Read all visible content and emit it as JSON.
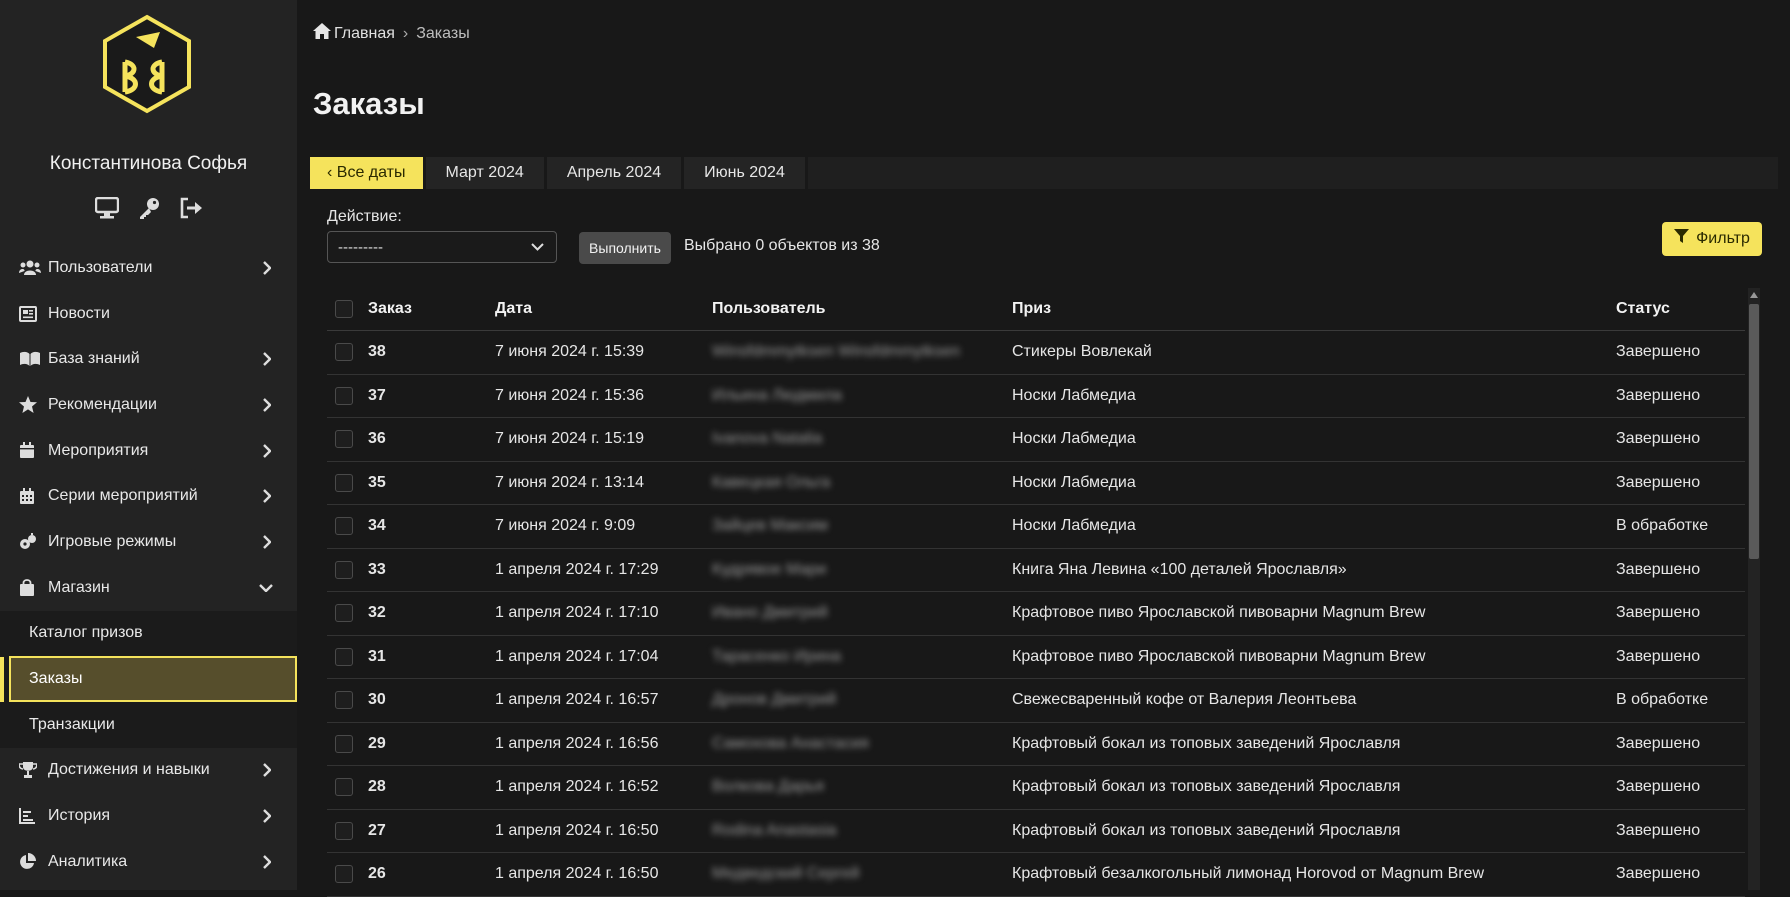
{
  "user": {
    "name": "Константинова Софья"
  },
  "user_icons": [
    "monitor-icon",
    "key-icon",
    "sign-out-icon"
  ],
  "sidebar": {
    "items": [
      {
        "label": "Пользователи",
        "icon": "users-icon",
        "chevron": "right"
      },
      {
        "label": "Новости",
        "icon": "newspaper-icon",
        "chevron": ""
      },
      {
        "label": "База знаний",
        "icon": "book-icon",
        "chevron": "right"
      },
      {
        "label": "Рекомендации",
        "icon": "star-icon",
        "chevron": "right"
      },
      {
        "label": "Мероприятия",
        "icon": "calendar-icon",
        "chevron": "right"
      },
      {
        "label": "Серии мероприятий",
        "icon": "calendar-grid-icon",
        "chevron": "right"
      },
      {
        "label": "Игровые режимы",
        "icon": "gamepad-icon",
        "chevron": "right"
      },
      {
        "label": "Магазин",
        "icon": "shopping-bag-icon",
        "chevron": "down"
      }
    ],
    "shop_subitems": [
      "Каталог призов",
      "Заказы",
      "Транзакции"
    ],
    "items_after": [
      {
        "label": "Достижения и навыки",
        "icon": "trophy-icon",
        "chevron": "right"
      },
      {
        "label": "История",
        "icon": "chart-bar-icon",
        "chevron": "right"
      },
      {
        "label": "Аналитика",
        "icon": "pie-chart-icon",
        "chevron": "right"
      }
    ]
  },
  "breadcrumb": {
    "home": "Главная",
    "separator": "›",
    "current": "Заказы"
  },
  "page_title": "Заказы",
  "date_filter": {
    "back": "‹ Все даты",
    "months": [
      "Март 2024",
      "Апрель 2024",
      "Июнь 2024"
    ]
  },
  "actions": {
    "label": "Действие:",
    "select_value": "---------",
    "run_button": "Выполнить",
    "selected_text": "Выбрано 0 объектов из 38"
  },
  "filter_button": "Фильтр",
  "table": {
    "headers": {
      "id": "Заказ",
      "date": "Дата",
      "user": "Пользователь",
      "prize": "Приз",
      "status": "Статус"
    },
    "rows": [
      {
        "id": "38",
        "date": "7 июня 2024 г. 15:39",
        "user": "Winsfdmmytksen Winsfdmmytksen",
        "prize": "Стикеры Вовлекай",
        "status": "Завершено"
      },
      {
        "id": "37",
        "date": "7 июня 2024 г. 15:36",
        "user": "Ильина Людмила",
        "prize": "Носки Лабмедиа",
        "status": "Завершено"
      },
      {
        "id": "36",
        "date": "7 июня 2024 г. 15:19",
        "user": "Ivanova Natalia",
        "prize": "Носки Лабмедиа",
        "status": "Завершено"
      },
      {
        "id": "35",
        "date": "7 июня 2024 г. 13:14",
        "user": "Кавецкая Ольга",
        "prize": "Носки Лабмедиа",
        "status": "Завершено"
      },
      {
        "id": "34",
        "date": "7 июня 2024 г. 9:09",
        "user": "Зайцев Максим",
        "prize": "Носки Лабмедиа",
        "status": "В обработке"
      },
      {
        "id": "33",
        "date": "1 апреля 2024 г. 17:29",
        "user": "Кудрявое Мари",
        "prize": "Книга Яна Левина «100 деталей Ярославля»",
        "status": "Завершено"
      },
      {
        "id": "32",
        "date": "1 апреля 2024 г. 17:10",
        "user": "Ивано Дмитрий",
        "prize": "Крафтовое пиво Ярославской пивоварни Magnum Brew",
        "status": "Завершено"
      },
      {
        "id": "31",
        "date": "1 апреля 2024 г. 17:04",
        "user": "Тарасенко Ирина",
        "prize": "Крафтовое пиво Ярославской пивоварни Magnum Brew",
        "status": "Завершено"
      },
      {
        "id": "30",
        "date": "1 апреля 2024 г. 16:57",
        "user": "Дронов Дмитрий",
        "prize": "Свежесваренный кофе от Валерия Леонтьева",
        "status": "В обработке"
      },
      {
        "id": "29",
        "date": "1 апреля 2024 г. 16:56",
        "user": "Самохова Анастасия",
        "prize": "Крафтовый бокал из топовых заведений Ярославля",
        "status": "Завершено"
      },
      {
        "id": "28",
        "date": "1 апреля 2024 г. 16:52",
        "user": "Волкова Дарья",
        "prize": "Крафтовый бокал из топовых заведений Ярославля",
        "status": "Завершено"
      },
      {
        "id": "27",
        "date": "1 апреля 2024 г. 16:50",
        "user": "Rodina Anastasia",
        "prize": "Крафтовый бокал из топовых заведений Ярославля",
        "status": "Завершено"
      },
      {
        "id": "26",
        "date": "1 апреля 2024 г. 16:50",
        "user": "Медведский Сергей",
        "prize": "Крафтовый безалкогольный лимонад Horovod от Magnum Brew",
        "status": "Завершено"
      }
    ]
  },
  "colors": {
    "accent": "#f5e35c",
    "sidebar_bg": "#232323",
    "page_bg": "#181818"
  }
}
